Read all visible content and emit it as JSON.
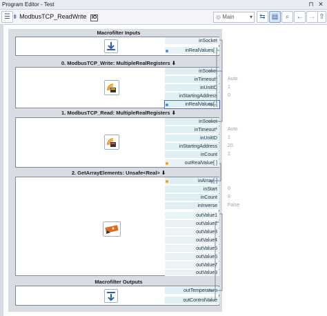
{
  "window": {
    "title": "Program Editor - Test",
    "pin_label": "⊓",
    "close_label": "✕"
  },
  "toolbar": {
    "macro_name": "ModbusTCP_ReadWrite",
    "io_badge": "IO",
    "view_select": "Main",
    "icons": [
      "menu-icon",
      "macro-icon",
      "swap-icon",
      "table-icon",
      "search-icon",
      "back-icon",
      "forward-icon",
      "up-icon",
      "more-icon"
    ]
  },
  "blocks": {
    "inputs": {
      "title": "Macrofilter Inputs",
      "ports": [
        {
          "label": "inSocket"
        },
        {
          "label": "inRealValues[ ]"
        }
      ]
    },
    "write": {
      "title": "0. ModbusTCP_Write: MultipleRealRegisters",
      "ports": [
        {
          "label": "inSocket",
          "value": ""
        },
        {
          "label": "inTimeout*",
          "value": "Auto"
        },
        {
          "label": "inUnitID",
          "value": "1"
        },
        {
          "label": "inStartingAddress",
          "value": "0"
        },
        {
          "label": "inRealValues[ ]",
          "value": ""
        }
      ]
    },
    "read": {
      "title": "1. ModbusTCP_Read: MultipleRealRegisters",
      "ports": [
        {
          "label": "inSocket",
          "value": ""
        },
        {
          "label": "inTimeout*",
          "value": "Auto"
        },
        {
          "label": "inUnitID",
          "value": "1"
        },
        {
          "label": "inStartingAddress",
          "value": "20"
        },
        {
          "label": "inCount",
          "value": "2"
        },
        {
          "label": "outRealValue[ ]",
          "value": ""
        }
      ]
    },
    "getarray": {
      "title": "2. GetArrayElements: Unsafe<Real>",
      "ports": [
        {
          "label": "inArray[ ]",
          "value": ""
        },
        {
          "label": "inStart",
          "value": "0"
        },
        {
          "label": "inCount",
          "value": "8"
        },
        {
          "label": "inInverse",
          "value": "False"
        },
        {
          "label": "outValue1",
          "value": ""
        },
        {
          "label": "outValue2",
          "value": ""
        },
        {
          "label": "outValue3",
          "value": ""
        },
        {
          "label": "outValue4",
          "value": ""
        },
        {
          "label": "outValue5",
          "value": ""
        },
        {
          "label": "outValue6",
          "value": ""
        },
        {
          "label": "outValue7",
          "value": ""
        },
        {
          "label": "outValue8",
          "value": ""
        }
      ]
    },
    "outputs": {
      "title": "Macrofilter Outputs",
      "ports": [
        {
          "label": "outTemperature"
        },
        {
          "label": "outControlValue"
        }
      ]
    }
  },
  "colors": {
    "port_bg": "#def0f3",
    "connection": "#7a8797",
    "marker": "#f2a400"
  }
}
